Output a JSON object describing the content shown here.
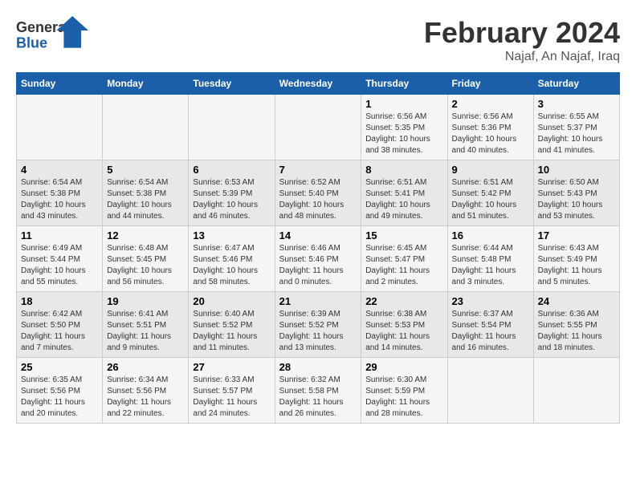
{
  "header": {
    "logo_text_general": "General",
    "logo_text_blue": "Blue",
    "main_title": "February 2024",
    "subtitle": "Najaf, An Najaf, Iraq"
  },
  "calendar": {
    "days_of_week": [
      "Sunday",
      "Monday",
      "Tuesday",
      "Wednesday",
      "Thursday",
      "Friday",
      "Saturday"
    ],
    "weeks": [
      [
        {
          "day": "",
          "info": ""
        },
        {
          "day": "",
          "info": ""
        },
        {
          "day": "",
          "info": ""
        },
        {
          "day": "",
          "info": ""
        },
        {
          "day": "1",
          "info": "Sunrise: 6:56 AM\nSunset: 5:35 PM\nDaylight: 10 hours\nand 38 minutes."
        },
        {
          "day": "2",
          "info": "Sunrise: 6:56 AM\nSunset: 5:36 PM\nDaylight: 10 hours\nand 40 minutes."
        },
        {
          "day": "3",
          "info": "Sunrise: 6:55 AM\nSunset: 5:37 PM\nDaylight: 10 hours\nand 41 minutes."
        }
      ],
      [
        {
          "day": "4",
          "info": "Sunrise: 6:54 AM\nSunset: 5:38 PM\nDaylight: 10 hours\nand 43 minutes."
        },
        {
          "day": "5",
          "info": "Sunrise: 6:54 AM\nSunset: 5:38 PM\nDaylight: 10 hours\nand 44 minutes."
        },
        {
          "day": "6",
          "info": "Sunrise: 6:53 AM\nSunset: 5:39 PM\nDaylight: 10 hours\nand 46 minutes."
        },
        {
          "day": "7",
          "info": "Sunrise: 6:52 AM\nSunset: 5:40 PM\nDaylight: 10 hours\nand 48 minutes."
        },
        {
          "day": "8",
          "info": "Sunrise: 6:51 AM\nSunset: 5:41 PM\nDaylight: 10 hours\nand 49 minutes."
        },
        {
          "day": "9",
          "info": "Sunrise: 6:51 AM\nSunset: 5:42 PM\nDaylight: 10 hours\nand 51 minutes."
        },
        {
          "day": "10",
          "info": "Sunrise: 6:50 AM\nSunset: 5:43 PM\nDaylight: 10 hours\nand 53 minutes."
        }
      ],
      [
        {
          "day": "11",
          "info": "Sunrise: 6:49 AM\nSunset: 5:44 PM\nDaylight: 10 hours\nand 55 minutes."
        },
        {
          "day": "12",
          "info": "Sunrise: 6:48 AM\nSunset: 5:45 PM\nDaylight: 10 hours\nand 56 minutes."
        },
        {
          "day": "13",
          "info": "Sunrise: 6:47 AM\nSunset: 5:46 PM\nDaylight: 10 hours\nand 58 minutes."
        },
        {
          "day": "14",
          "info": "Sunrise: 6:46 AM\nSunset: 5:46 PM\nDaylight: 11 hours\nand 0 minutes."
        },
        {
          "day": "15",
          "info": "Sunrise: 6:45 AM\nSunset: 5:47 PM\nDaylight: 11 hours\nand 2 minutes."
        },
        {
          "day": "16",
          "info": "Sunrise: 6:44 AM\nSunset: 5:48 PM\nDaylight: 11 hours\nand 3 minutes."
        },
        {
          "day": "17",
          "info": "Sunrise: 6:43 AM\nSunset: 5:49 PM\nDaylight: 11 hours\nand 5 minutes."
        }
      ],
      [
        {
          "day": "18",
          "info": "Sunrise: 6:42 AM\nSunset: 5:50 PM\nDaylight: 11 hours\nand 7 minutes."
        },
        {
          "day": "19",
          "info": "Sunrise: 6:41 AM\nSunset: 5:51 PM\nDaylight: 11 hours\nand 9 minutes."
        },
        {
          "day": "20",
          "info": "Sunrise: 6:40 AM\nSunset: 5:52 PM\nDaylight: 11 hours\nand 11 minutes."
        },
        {
          "day": "21",
          "info": "Sunrise: 6:39 AM\nSunset: 5:52 PM\nDaylight: 11 hours\nand 13 minutes."
        },
        {
          "day": "22",
          "info": "Sunrise: 6:38 AM\nSunset: 5:53 PM\nDaylight: 11 hours\nand 14 minutes."
        },
        {
          "day": "23",
          "info": "Sunrise: 6:37 AM\nSunset: 5:54 PM\nDaylight: 11 hours\nand 16 minutes."
        },
        {
          "day": "24",
          "info": "Sunrise: 6:36 AM\nSunset: 5:55 PM\nDaylight: 11 hours\nand 18 minutes."
        }
      ],
      [
        {
          "day": "25",
          "info": "Sunrise: 6:35 AM\nSunset: 5:56 PM\nDaylight: 11 hours\nand 20 minutes."
        },
        {
          "day": "26",
          "info": "Sunrise: 6:34 AM\nSunset: 5:56 PM\nDaylight: 11 hours\nand 22 minutes."
        },
        {
          "day": "27",
          "info": "Sunrise: 6:33 AM\nSunset: 5:57 PM\nDaylight: 11 hours\nand 24 minutes."
        },
        {
          "day": "28",
          "info": "Sunrise: 6:32 AM\nSunset: 5:58 PM\nDaylight: 11 hours\nand 26 minutes."
        },
        {
          "day": "29",
          "info": "Sunrise: 6:30 AM\nSunset: 5:59 PM\nDaylight: 11 hours\nand 28 minutes."
        },
        {
          "day": "",
          "info": ""
        },
        {
          "day": "",
          "info": ""
        }
      ]
    ]
  }
}
